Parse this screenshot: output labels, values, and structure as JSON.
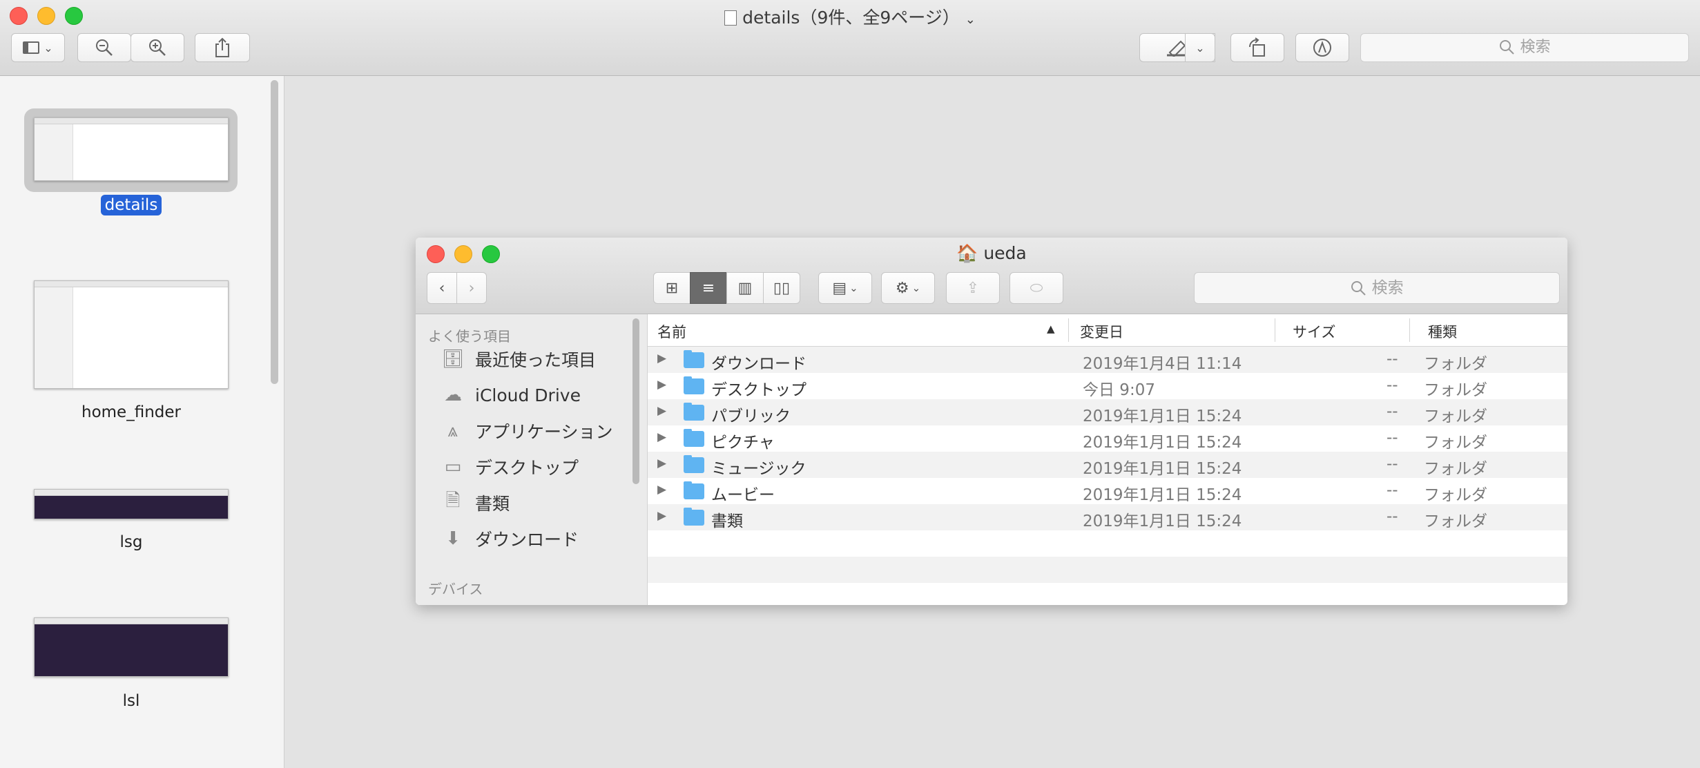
{
  "window": {
    "title": "details（9件、全9ページ）",
    "search_placeholder": "検索"
  },
  "sidebar": {
    "thumbnails": [
      {
        "label": "details",
        "selected": true
      },
      {
        "label": "home_finder",
        "selected": false
      },
      {
        "label": "lsg",
        "selected": false
      },
      {
        "label": "lsl",
        "selected": false
      }
    ]
  },
  "finder": {
    "title": "ueda",
    "search_placeholder": "検索",
    "sidebar": {
      "favorites_header": "よく使う項目",
      "devices_header": "デバイス",
      "items": [
        {
          "label": "最近使った項目",
          "icon": "recents-icon"
        },
        {
          "label": "iCloud Drive",
          "icon": "cloud-icon"
        },
        {
          "label": "アプリケーション",
          "icon": "applications-icon"
        },
        {
          "label": "デスクトップ",
          "icon": "desktop-icon"
        },
        {
          "label": "書類",
          "icon": "documents-icon"
        },
        {
          "label": "ダウンロード",
          "icon": "downloads-icon"
        }
      ]
    },
    "columns": {
      "name": "名前",
      "modified": "変更日",
      "size": "サイズ",
      "kind": "種類"
    },
    "rows": [
      {
        "name": "ダウンロード",
        "modified": "2019年1月4日 11:14",
        "size": "--",
        "kind": "フォルダ"
      },
      {
        "name": "デスクトップ",
        "modified": "今日 9:07",
        "size": "--",
        "kind": "フォルダ"
      },
      {
        "name": "パブリック",
        "modified": "2019年1月1日 15:24",
        "size": "--",
        "kind": "フォルダ"
      },
      {
        "name": "ピクチャ",
        "modified": "2019年1月1日 15:24",
        "size": "--",
        "kind": "フォルダ"
      },
      {
        "name": "ミュージック",
        "modified": "2019年1月1日 15:24",
        "size": "--",
        "kind": "フォルダ"
      },
      {
        "name": "ムービー",
        "modified": "2019年1月1日 15:24",
        "size": "--",
        "kind": "フォルダ"
      },
      {
        "name": "書類",
        "modified": "2019年1月1日 15:24",
        "size": "--",
        "kind": "フォルダ"
      }
    ]
  }
}
